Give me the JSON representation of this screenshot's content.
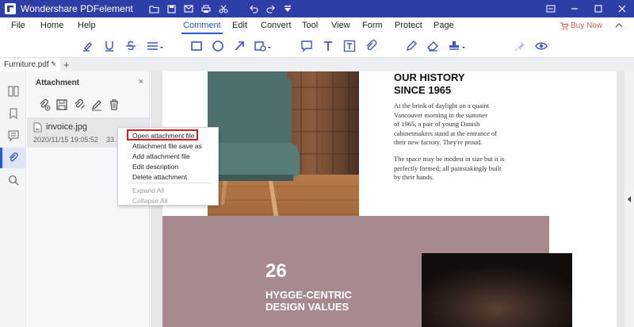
{
  "app": {
    "title": "Wondershare PDFelement",
    "accent": "#2d3ea6"
  },
  "menu": {
    "items": [
      "File",
      "Home",
      "Help",
      "Comment",
      "Edit",
      "Convert",
      "Tool",
      "View",
      "Form",
      "Protect",
      "Page"
    ],
    "active": "Comment",
    "buy_now": "Buy Now"
  },
  "toolbar": {
    "icons": [
      "highlight-icon",
      "underline-icon",
      "strikethrough-icon",
      "line-style-icon",
      "rectangle-icon",
      "oval-icon",
      "arrow-icon",
      "shape-icon",
      "sticky-note-icon",
      "text-icon",
      "text-box-icon",
      "attachment-icon",
      "pencil-icon",
      "eraser-icon",
      "stamp-icon",
      "pin-icon",
      "eye-icon"
    ]
  },
  "tab": {
    "file_name": "Furniture.pdf *",
    "close": "×",
    "add": "+"
  },
  "panel": {
    "title": "Attachment",
    "close": "×",
    "attachment": {
      "name": "invoice.jpg",
      "date": "2020/11/15 19:05:52",
      "size": "33."
    }
  },
  "context_menu": {
    "items": [
      "Open attachment file",
      "Attachment file save as",
      "Add attachment file",
      "Edit description",
      "Delete attachment"
    ],
    "disabled_items": [
      "Expand All",
      "Collapse All"
    ],
    "highlighted": "Open attachment file",
    "highlight_color": "#d01f24"
  },
  "document": {
    "heading": "OUR HISTORY\nSINCE 1965",
    "paragraph1": "At the brink of daylight on a quaint\nVancouver morning in the summer\nof 1965, a pair of young Danish\ncabinetmakers stand at the entrance of\ntheir new factory. They're proud.",
    "paragraph2": "The space may be modest in size but it is\nperfectly formed; all painstakingly built\nby their hands.",
    "number": "26",
    "section_title": "HYGGE-CENTRIC\nDESIGN VALUES",
    "band_color": "#a68a8d"
  }
}
